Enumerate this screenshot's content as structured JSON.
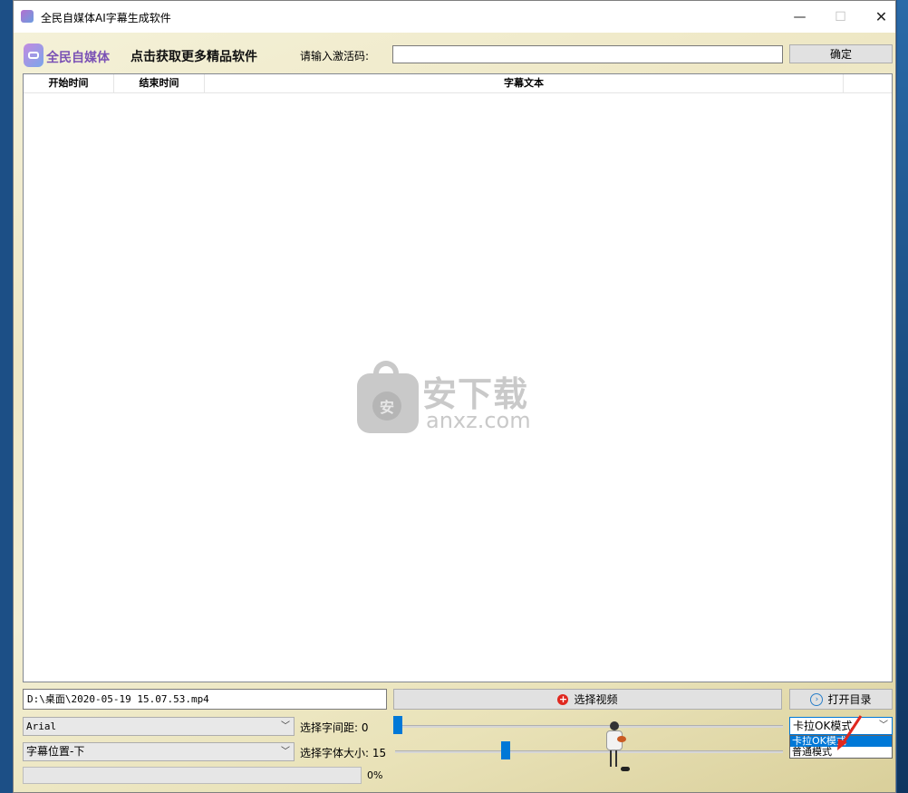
{
  "window": {
    "title": "全民自媒体AI字幕生成软件",
    "controls": {
      "minimize": "—",
      "maximize": "☐",
      "close": "✕"
    }
  },
  "header": {
    "logo_text": "全民自媒体",
    "promo_link": "点击获取更多精品软件",
    "activation_label": "请输入激活码:",
    "activation_value": "",
    "confirm_button": "确定"
  },
  "table": {
    "columns": [
      "开始时间",
      "结束时间",
      "字幕文本"
    ],
    "rows": []
  },
  "watermark": {
    "seal": "安",
    "cn": "安下载",
    "en": "anxz.com"
  },
  "controls": {
    "video_path": "D:\\桌面\\2020-05-19 15.07.53.mp4",
    "select_video_button": "选择视频",
    "open_dir_button": "打开目录",
    "font_select": "Arial",
    "spacing_label": "选择字间距: 0",
    "spacing_value": 0,
    "position_select": "字幕位置-下",
    "size_label": "选择字体大小: 15",
    "size_value": 15,
    "progress_percent": 0,
    "progress_text": "0%",
    "mode_select": "卡拉OK模式",
    "mode_options": [
      "卡拉OK模式",
      "普通模式"
    ],
    "mode_selected_index": 0
  },
  "icons": {
    "app": "app-logo-icon",
    "plus": "plus-circle-icon",
    "open_dir": "arrow-circle-icon",
    "dropdown": "chevron-down-icon"
  },
  "colors": {
    "accent": "#0078d7",
    "plus_red": "#e0281f",
    "logo_purple": "#7b52b5",
    "arrow_red": "#e0281f"
  }
}
